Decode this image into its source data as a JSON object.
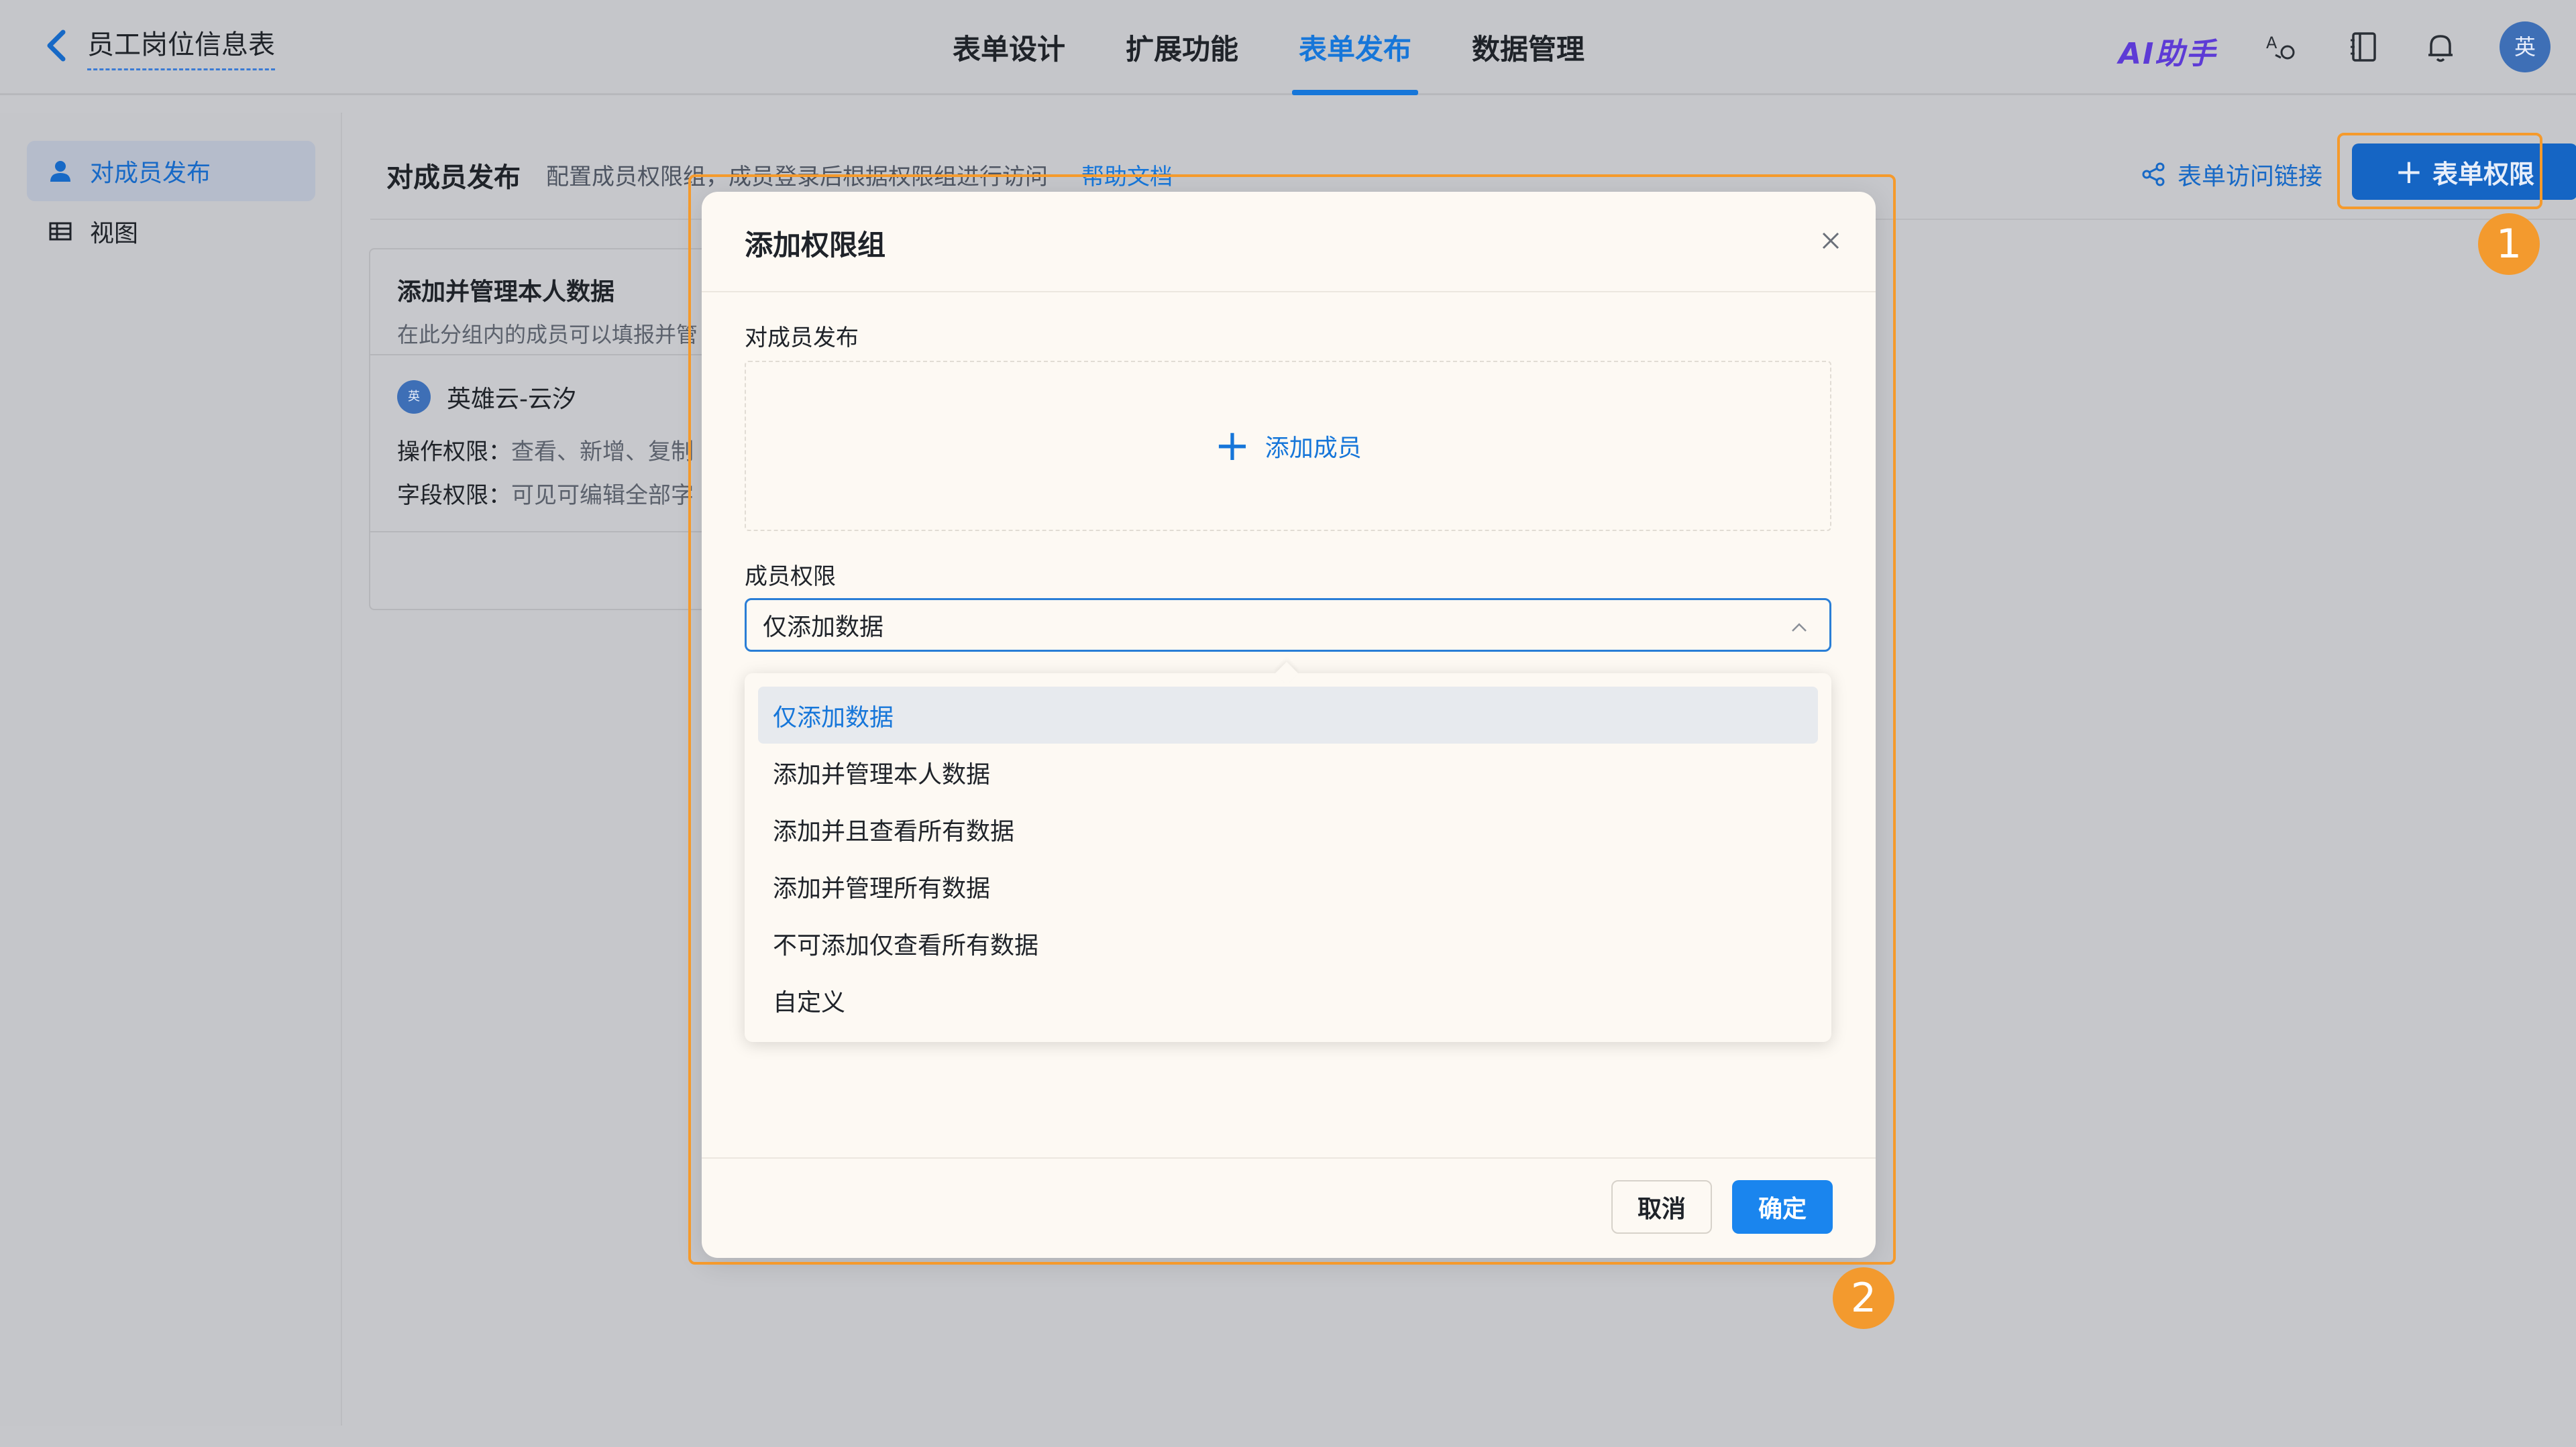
{
  "header": {
    "form_title": "员工岗位信息表",
    "tabs": [
      {
        "label": "表单设计",
        "active": false
      },
      {
        "label": "扩展功能",
        "active": false
      },
      {
        "label": "表单发布",
        "active": true
      },
      {
        "label": "数据管理",
        "active": false
      }
    ],
    "ai_label": "AI助手",
    "avatar_text": "英",
    "icons": [
      "translate-icon",
      "book-icon",
      "bell-icon"
    ]
  },
  "sidebar": {
    "items": [
      {
        "label": "对成员发布",
        "icon": "user-icon",
        "active": true
      },
      {
        "label": "视图",
        "icon": "table-icon",
        "active": false
      }
    ]
  },
  "main": {
    "title": "对成员发布",
    "description": "配置成员权限组，成员登录后根据权限组进行访问",
    "help_link": "帮助文档",
    "share_link": "表单访问链接",
    "permission_button": "表单权限"
  },
  "card": {
    "title": "添加并管理本人数据",
    "subtitle": "在此分组内的成员可以填报并管",
    "user_avatar": "英",
    "user_name": "英雄云-云汐",
    "op_label": "操作权限：",
    "op_value": "查看、新增、复制",
    "field_label": "字段权限：",
    "field_value": "可见可编辑全部字"
  },
  "modal": {
    "title": "添加权限组",
    "members_label": "对成员发布",
    "add_member": "添加成员",
    "permission_label": "成员权限",
    "selected_value": "仅添加数据",
    "options": [
      "仅添加数据",
      "添加并管理本人数据",
      "添加并且查看所有数据",
      "添加并管理所有数据",
      "不可添加仅查看所有数据",
      "自定义"
    ],
    "cancel": "取消",
    "confirm": "确定"
  },
  "annotations": {
    "badge1": "1",
    "badge2": "2",
    "color": "#f59a2c"
  },
  "colors": {
    "accent": "#1676d9",
    "primary_button": "#1a85ee",
    "ai": "#5d3bd6"
  }
}
